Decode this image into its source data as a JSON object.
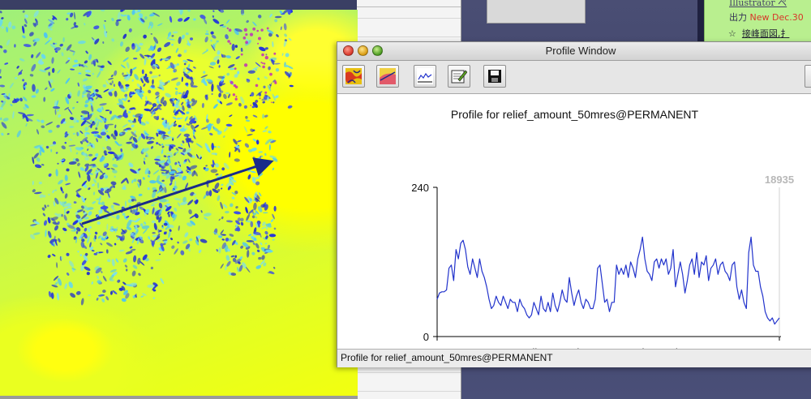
{
  "background": {
    "note_lines": {
      "line1": "Illustrator ペ",
      "line2_prefix": "出力 ",
      "line2_new": "New Dec.30",
      "line3_star": "☆",
      "line3_text": "接峰面図,扌"
    }
  },
  "window": {
    "title": "Profile Window",
    "toolbar": [
      {
        "name": "draw-profile-button",
        "icon": "raster-map-icon"
      },
      {
        "name": "draw-transect-button",
        "icon": "map-transect-icon"
      },
      {
        "name": "plot-profile-button",
        "icon": "profile-graph-icon"
      },
      {
        "name": "options-button",
        "icon": "edit-options-icon"
      },
      {
        "name": "save-button",
        "icon": "save-disk-icon"
      }
    ],
    "plot_title": "Profile for relief_amount_50mres@PERMANENT",
    "status_text": "Profile for relief_amount_50mres@PERMANENT"
  },
  "chart_data": {
    "type": "line",
    "title": "Profile for relief_amount_50mres@PERMANENT",
    "xlabel": "distance along transect (metres)",
    "ylabel": "",
    "xlim": [
      0,
      18935
    ],
    "ylim": [
      0,
      240
    ],
    "x_tick_labels": [
      "0",
      "18935"
    ],
    "y_tick_labels": [
      "0",
      "240"
    ],
    "top_right_label": "18935",
    "line_color": "#2233cc",
    "grid": false,
    "values": [
      60,
      70,
      72,
      72,
      75,
      110,
      115,
      90,
      140,
      125,
      150,
      155,
      140,
      112,
      100,
      125,
      110,
      95,
      125,
      105,
      95,
      80,
      60,
      45,
      50,
      65,
      55,
      50,
      65,
      55,
      45,
      60,
      55,
      55,
      40,
      60,
      50,
      45,
      35,
      30,
      35,
      55,
      45,
      35,
      65,
      45,
      40,
      55,
      40,
      70,
      50,
      40,
      55,
      75,
      60,
      55,
      95,
      70,
      50,
      65,
      75,
      55,
      45,
      60,
      55,
      45,
      45,
      60,
      110,
      115,
      85,
      55,
      60,
      40,
      55,
      55,
      115,
      100,
      110,
      100,
      115,
      95,
      120,
      110,
      95,
      125,
      140,
      160,
      125,
      105,
      100,
      90,
      120,
      125,
      110,
      125,
      115,
      125,
      100,
      110,
      140,
      80,
      100,
      120,
      100,
      70,
      90,
      115,
      125,
      100,
      135,
      95,
      120,
      115,
      130,
      90,
      110,
      115,
      125,
      100,
      115,
      120,
      105,
      100,
      90,
      115,
      120,
      80,
      60,
      75,
      55,
      45,
      135,
      160,
      115,
      105,
      105,
      80,
      65,
      40,
      30,
      25,
      30,
      20,
      25,
      30
    ]
  }
}
